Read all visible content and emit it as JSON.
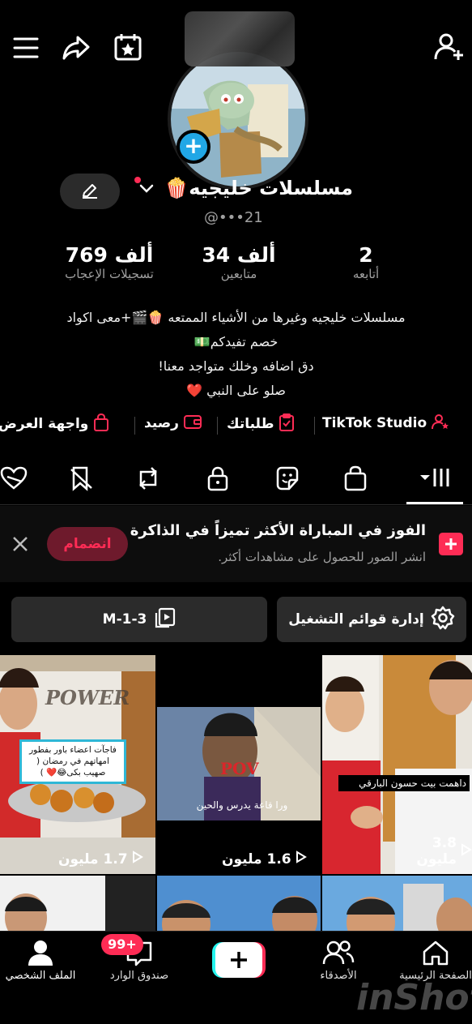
{
  "header": {
    "icons": [
      "menu-icon",
      "share-icon",
      "calendar-star-icon",
      "add-friend-icon"
    ]
  },
  "profile": {
    "name": "مسلسلات خليجيه",
    "name_emoji": "🍿",
    "username": "@•••21",
    "stats": [
      {
        "value": "2",
        "label": "أتابعه"
      },
      {
        "value": "34 ألف",
        "label": "متابعين"
      },
      {
        "value": "769 ألف",
        "label": "تسجيلات الإعجاب"
      }
    ],
    "bio": [
      "مسلسلات خليجيه وغيرها من الأشياء الممتعه 🍿🎬+معى اكواد",
      "خصم تفيدكم💵",
      "دق اضافه وخلك متواجد معنا!",
      "صلو على النبي ❤️"
    ]
  },
  "links": [
    {
      "label": "TikTok Studio",
      "icon": "person-star-icon"
    },
    {
      "label": "طلباتك",
      "icon": "clipboard-check-icon"
    },
    {
      "label": "رصيد",
      "icon": "wallet-icon"
    },
    {
      "label": "واجهة العرض",
      "icon": "shopping-bag-icon"
    }
  ],
  "tabs": [
    {
      "name": "videos",
      "icon": "grid-icon",
      "active": true
    },
    {
      "name": "shop",
      "icon": "shopping-bag-icon"
    },
    {
      "name": "stickers",
      "icon": "sticker-icon"
    },
    {
      "name": "private",
      "icon": "lock-icon"
    },
    {
      "name": "reposts",
      "icon": "repost-icon"
    },
    {
      "name": "favorites",
      "icon": "bookmark-slash-icon"
    },
    {
      "name": "liked",
      "icon": "heart-hidden-icon"
    }
  ],
  "banner": {
    "title": "الفوز في المباراة الأكثر تميزاً في الذاكرة",
    "subtitle": "انشر الصور للحصول على مشاهدات أكثر.",
    "join_label": "انضمام"
  },
  "buttons": {
    "manage_playlists": "إدارة قوائم التشغيل",
    "playlist": "M-1-3"
  },
  "videos": [
    {
      "views": "3.8 مليون",
      "caption": "داهمت بيت حسون البارقي"
    },
    {
      "views": "1.6 مليون",
      "caption": "ورا قاعة يدرس والحين",
      "overlay": "POV"
    },
    {
      "views": "1.7 مليون",
      "caption": "فاجآت اعضاء باور بفطور امهاتهم في رمضان ( صهيب بكى😂❤️ )",
      "brand": "POWER"
    }
  ],
  "bottom_nav": [
    {
      "label": "الصفحة الرئيسية",
      "icon": "home-icon"
    },
    {
      "label": "الأصدقاء",
      "icon": "friends-icon"
    },
    {
      "label": "",
      "icon": "plus-icon"
    },
    {
      "label": "صندوق الوارد",
      "icon": "inbox-icon",
      "badge": "99+"
    },
    {
      "label": "الملف الشخصي",
      "icon": "profile-icon"
    }
  ],
  "watermark": "inShot",
  "colors": {
    "accent": "#fe2c55",
    "cyan": "#25f4ee",
    "avatar_badge": "#21a7e6"
  }
}
